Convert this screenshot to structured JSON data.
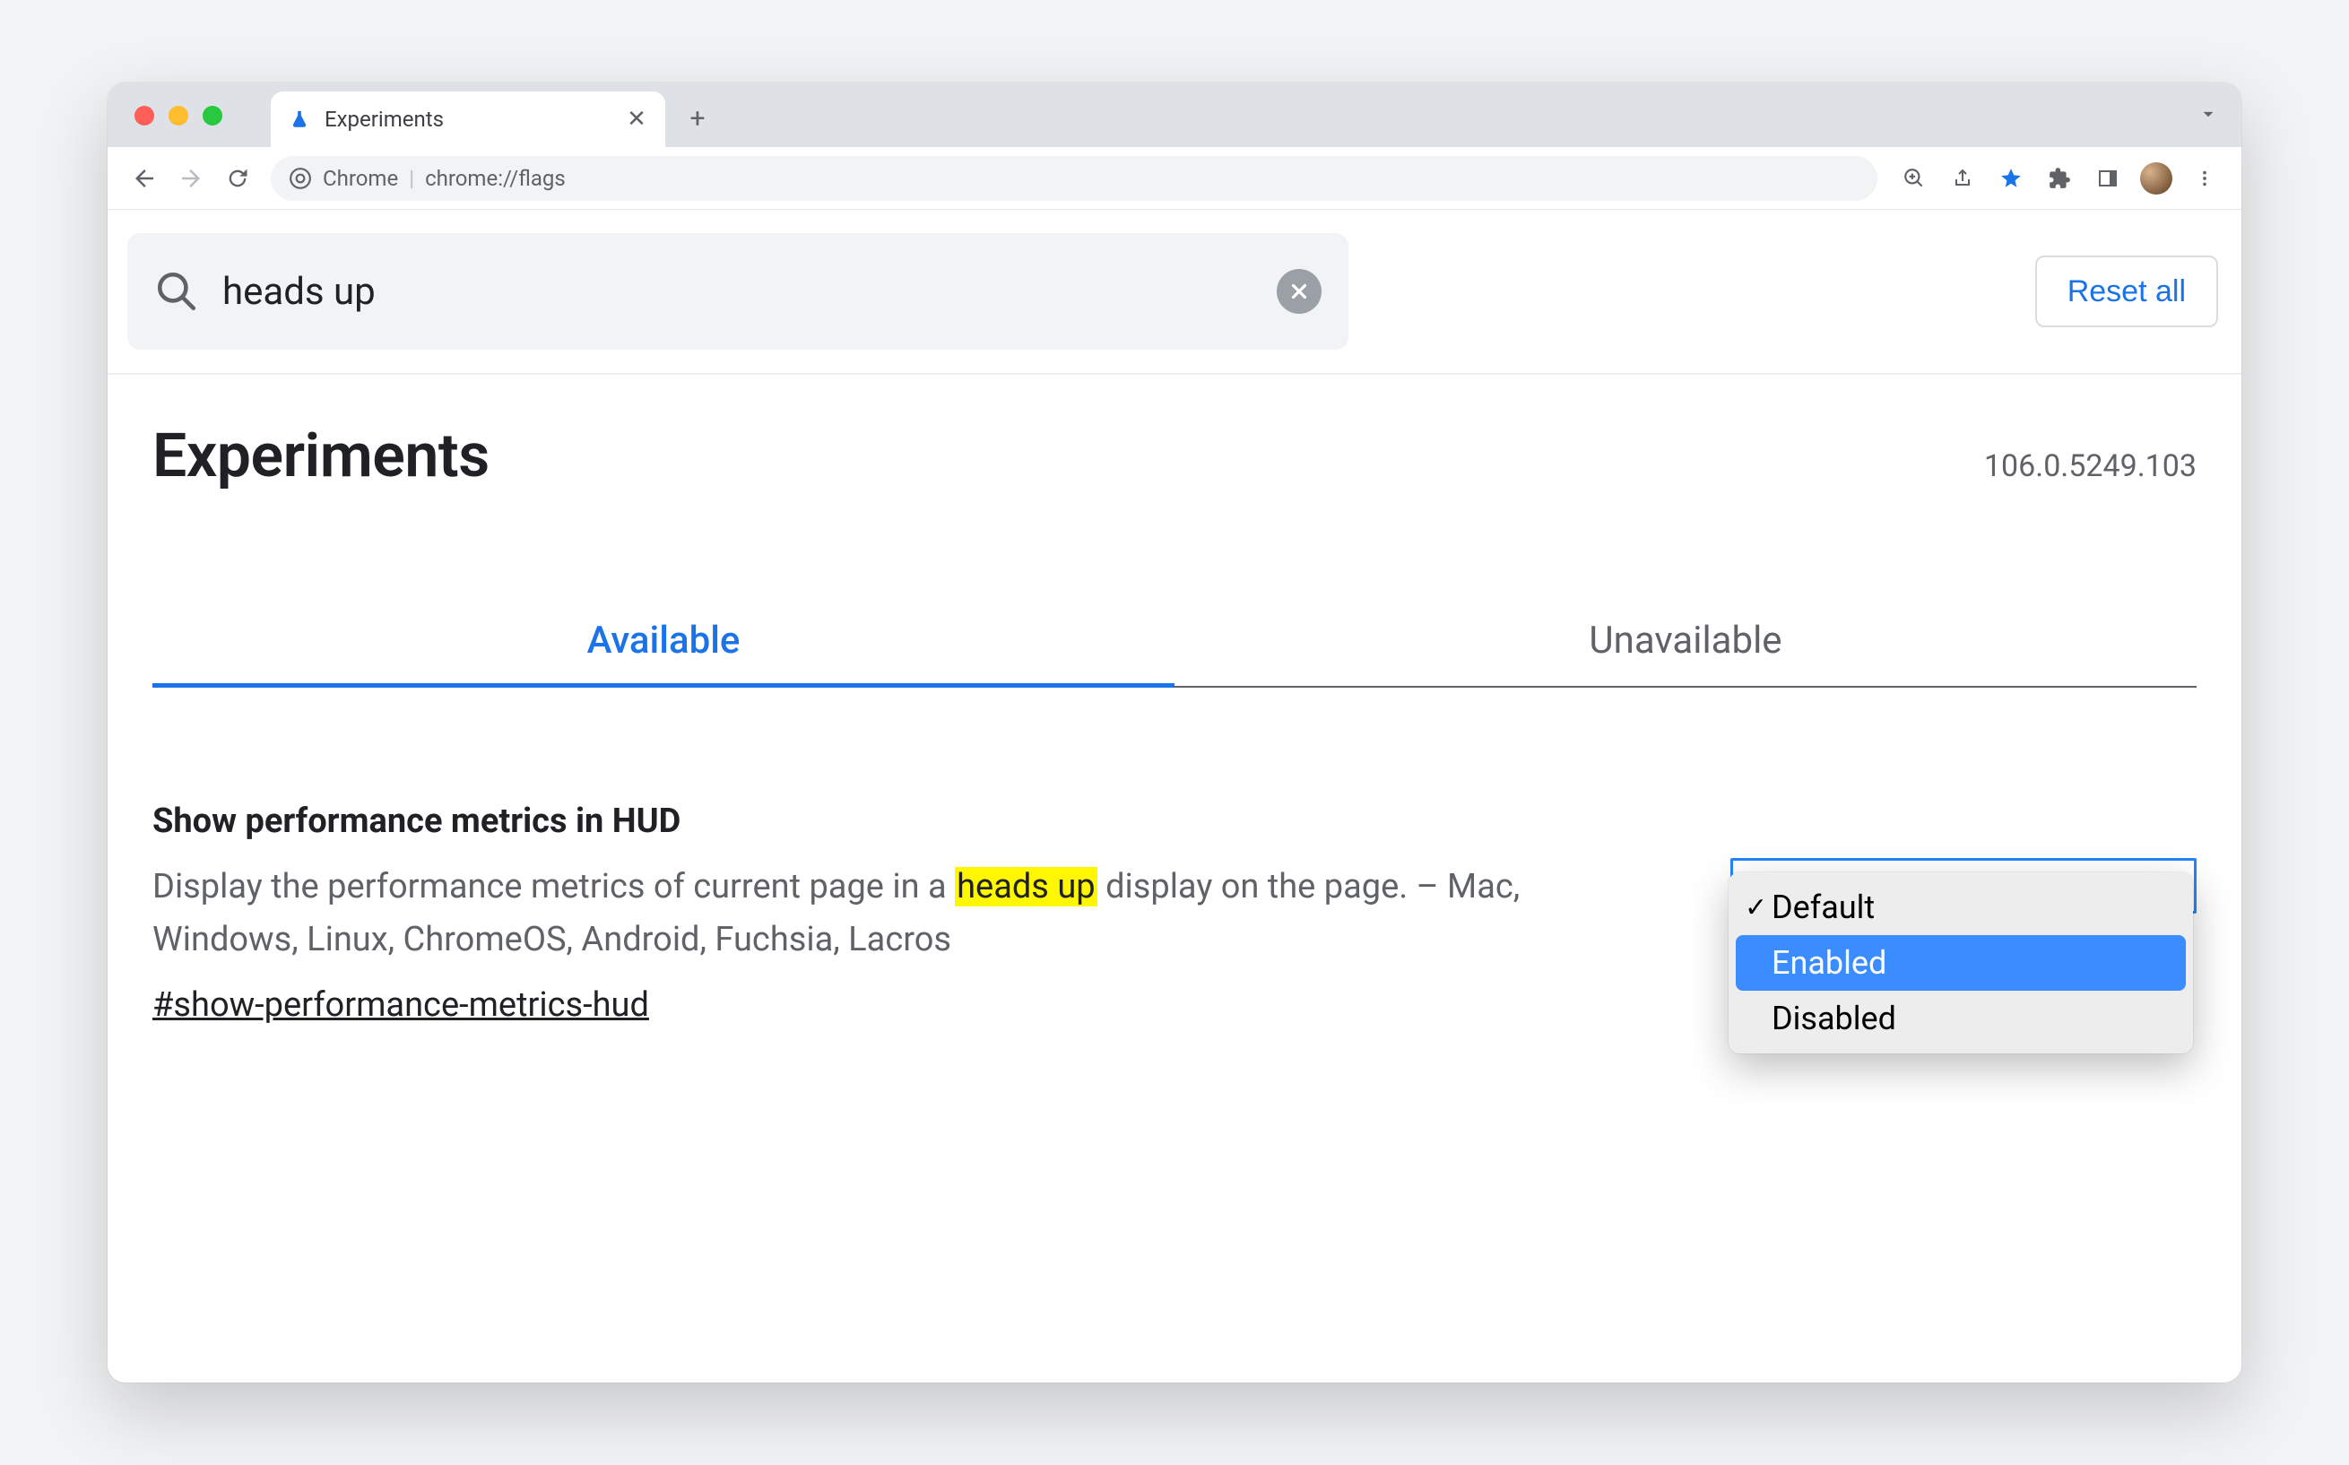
{
  "browser": {
    "tab_title": "Experiments",
    "omnibox_label": "Chrome",
    "omnibox_url": "chrome://flags"
  },
  "search": {
    "query": "heads up"
  },
  "reset_label": "Reset all",
  "page_title": "Experiments",
  "version": "106.0.5249.103",
  "tabs": {
    "available": "Available",
    "unavailable": "Unavailable"
  },
  "flag": {
    "title": "Show performance metrics in HUD",
    "desc_before": "Display the performance metrics of current page in a ",
    "desc_highlight": "heads up",
    "desc_after": " display on the page. – Mac, Windows, Linux, ChromeOS, Android, Fuchsia, Lacros",
    "hash": "#show-performance-metrics-hud",
    "options": {
      "default": "Default",
      "enabled": "Enabled",
      "disabled": "Disabled"
    }
  }
}
